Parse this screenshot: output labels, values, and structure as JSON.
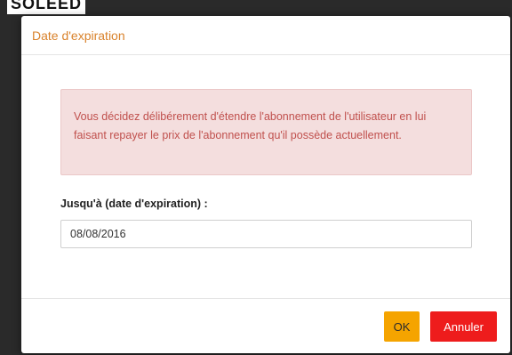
{
  "background": {
    "fragment_text": "SOLEED"
  },
  "modal": {
    "title": "Date d'expiration",
    "alert_text": "Vous décidez délibérement d'étendre l'abonnement de l'utilisateur en lui faisant repayer le prix de l'abonnement qu'il possède actuellement.",
    "field_label": "Jusqu'à (date d'expiration) :",
    "date_value": "08/08/2016",
    "ok_label": "OK",
    "cancel_label": "Annuler"
  },
  "colors": {
    "title": "#d9822b",
    "alert_bg": "#f4dede",
    "alert_text": "#c0504d",
    "ok_bg": "#f5a400",
    "cancel_bg": "#ee1c1c"
  }
}
